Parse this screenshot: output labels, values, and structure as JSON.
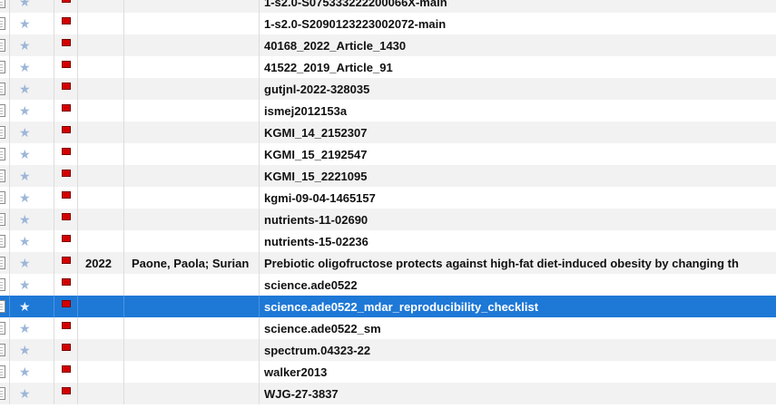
{
  "rows": [
    {
      "year": "",
      "authors": "",
      "title": "1-s2.0-S075333222200066X-main",
      "selected": false
    },
    {
      "year": "",
      "authors": "",
      "title": "1-s2.0-S2090123223002072-main",
      "selected": false
    },
    {
      "year": "",
      "authors": "",
      "title": "40168_2022_Article_1430",
      "selected": false
    },
    {
      "year": "",
      "authors": "",
      "title": "41522_2019_Article_91",
      "selected": false
    },
    {
      "year": "",
      "authors": "",
      "title": "gutjnl-2022-328035",
      "selected": false
    },
    {
      "year": "",
      "authors": "",
      "title": "ismej2012153a",
      "selected": false
    },
    {
      "year": "",
      "authors": "",
      "title": "KGMI_14_2152307",
      "selected": false
    },
    {
      "year": "",
      "authors": "",
      "title": "KGMI_15_2192547",
      "selected": false
    },
    {
      "year": "",
      "authors": "",
      "title": "KGMI_15_2221095",
      "selected": false
    },
    {
      "year": "",
      "authors": "",
      "title": "kgmi-09-04-1465157",
      "selected": false
    },
    {
      "year": "",
      "authors": "",
      "title": "nutrients-11-02690",
      "selected": false
    },
    {
      "year": "",
      "authors": "",
      "title": "nutrients-15-02236",
      "selected": false
    },
    {
      "year": "2022",
      "authors": "Paone, Paola; Surian",
      "title": "Prebiotic oligofructose protects against high-fat diet-induced obesity by changing th",
      "selected": false
    },
    {
      "year": "",
      "authors": "",
      "title": "science.ade0522",
      "selected": false
    },
    {
      "year": "",
      "authors": "",
      "title": "science.ade0522_mdar_reproducibility_checklist",
      "selected": true
    },
    {
      "year": "",
      "authors": "",
      "title": "science.ade0522_sm",
      "selected": false
    },
    {
      "year": "",
      "authors": "",
      "title": "spectrum.04323-22",
      "selected": false
    },
    {
      "year": "",
      "authors": "",
      "title": "walker2013",
      "selected": false
    },
    {
      "year": "",
      "authors": "",
      "title": "WJG-27-3837",
      "selected": false
    }
  ],
  "icons": {
    "document": "document-icon",
    "star": "star-icon",
    "flag": "red-flag-icon"
  },
  "colors": {
    "selection": "#1e78d6",
    "flag": "#d40000",
    "stripe": "#f2f2f2"
  }
}
